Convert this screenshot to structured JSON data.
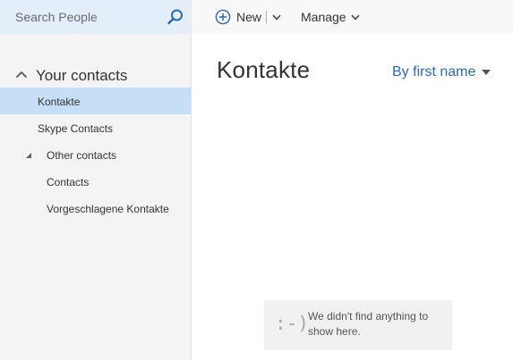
{
  "search": {
    "placeholder": "Search People"
  },
  "sidebar": {
    "section_title": "Your contacts",
    "items": [
      {
        "label": "Kontakte",
        "selected": true
      },
      {
        "label": "Skype Contacts"
      },
      {
        "label": "Other contacts",
        "expandable": true
      },
      {
        "label": "Contacts"
      },
      {
        "label": "Vorgeschlagene Kontakte"
      }
    ]
  },
  "toolbar": {
    "new_label": "New",
    "manage_label": "Manage"
  },
  "main": {
    "title": "Kontakte",
    "sort_label": "By first name",
    "empty_face": ":-)",
    "empty_message": "We didn't find anything to show here."
  },
  "colors": {
    "accent": "#2d6aae",
    "selected_bg": "#c7dff6",
    "search_bg": "#e4eef9",
    "sidebar_bg": "#f4f4f4",
    "toolbar_bg": "#f8f8f8"
  },
  "icons": {
    "search": "search-icon",
    "collapse": "chevron-up-icon",
    "expand": "expand-triangle-icon",
    "new": "plus-circle-icon",
    "dropdown": "chevron-down-icon",
    "sort": "caret-down-icon"
  }
}
